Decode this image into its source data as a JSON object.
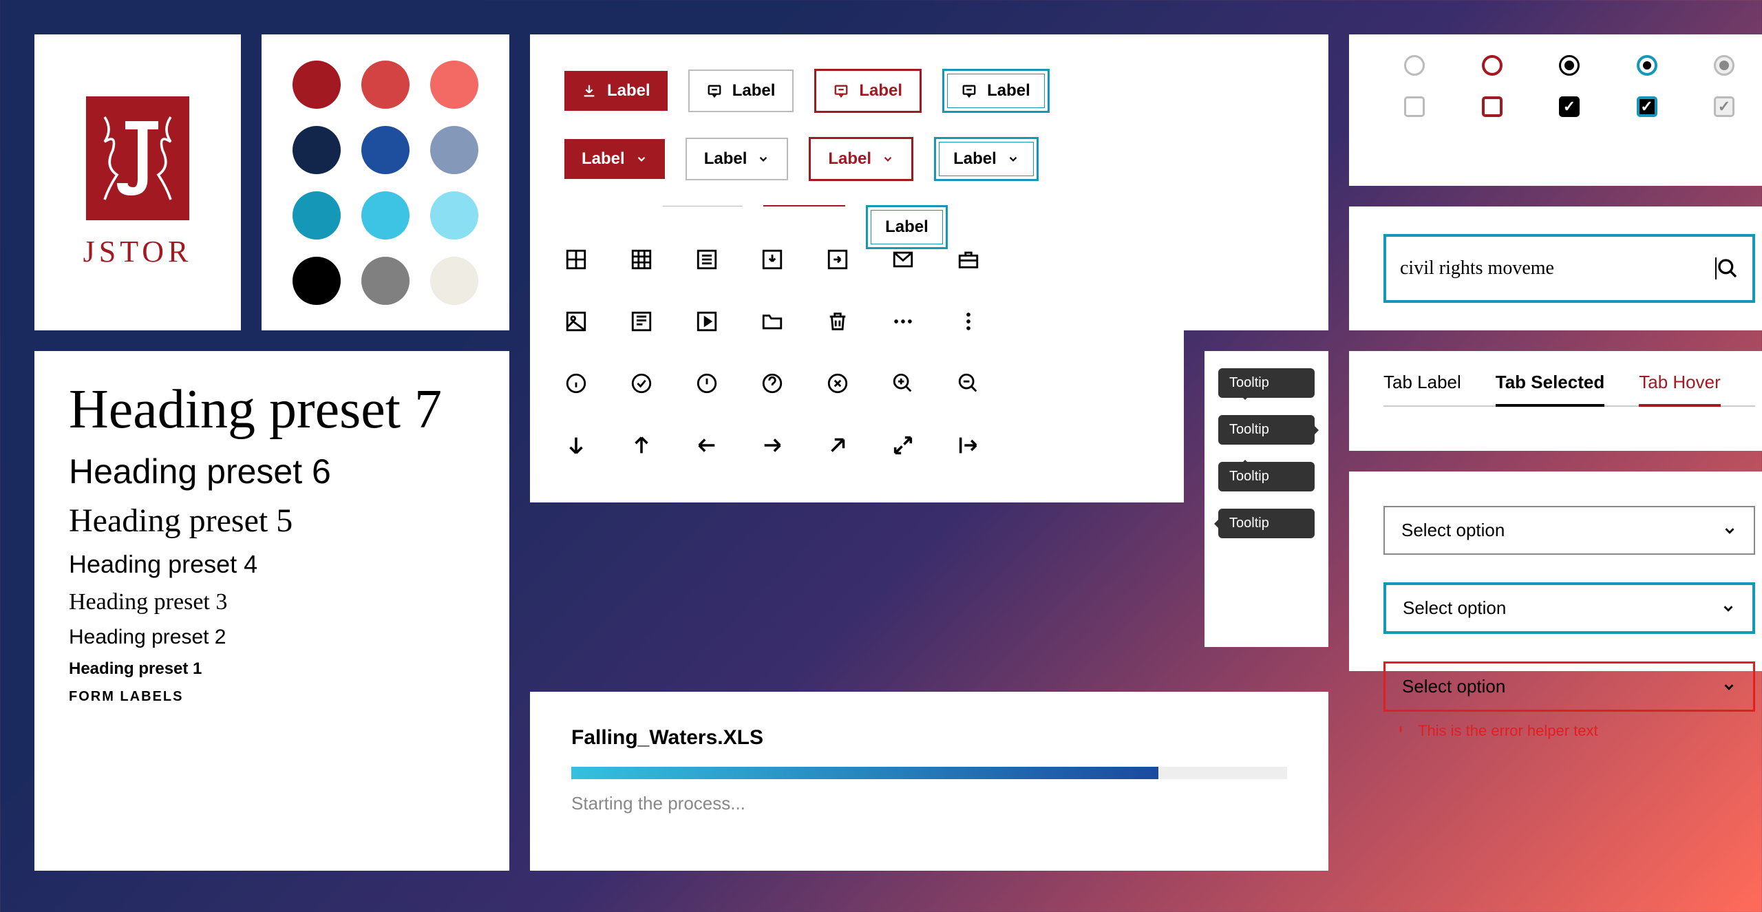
{
  "logo": {
    "wordmark": "JSTOR"
  },
  "palette": [
    "#a31921",
    "#d34343",
    "#f26a63",
    "#12264c",
    "#1d4f9e",
    "#8498b9",
    "#1597b8",
    "#3dc3e3",
    "#8ae0f2",
    "#000000",
    "#808080",
    "#efece3"
  ],
  "buttons": {
    "label": "Label"
  },
  "controls": {},
  "search": {
    "value": "civil rights moveme",
    "placeholder": ""
  },
  "typography": {
    "h7": "Heading preset 7",
    "h6": "Heading preset 6",
    "h5": "Heading preset 5",
    "h4": "Heading preset 4",
    "h3": "Heading preset 3",
    "h2": "Heading preset 2",
    "h1": "Heading preset 1",
    "form": "FORM LABELS"
  },
  "tooltip": {
    "label": "Tooltip"
  },
  "tabs": {
    "default": "Tab Label",
    "selected": "Tab Selected",
    "hover": "Tab Hover"
  },
  "progress": {
    "filename": "Falling_Waters.XLS",
    "status": "Starting the process...",
    "percent": 82
  },
  "select": {
    "placeholder": "Select option",
    "error_text": "This is the error helper text"
  }
}
